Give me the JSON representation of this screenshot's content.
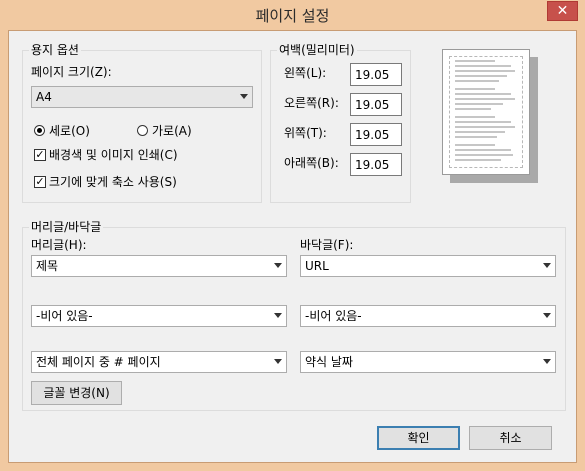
{
  "window": {
    "title": "페이지 설정",
    "close_glyph": "✕"
  },
  "paper_options": {
    "group_label": "용지 옵션",
    "size_label": "페이지 크기(Z):",
    "size_value": "A4",
    "portrait_label": "세로(O)",
    "landscape_label": "가로(A)",
    "orientation_selected": "portrait",
    "print_bg_label": "배경색 및 이미지 인쇄(C)",
    "print_bg_checked": true,
    "shrink_label": "크기에 맞게 축소 사용(S)",
    "shrink_checked": true
  },
  "margins": {
    "group_label": "여백(밀리미터)",
    "left_label": "왼쪽(L):",
    "left_value": "19.05",
    "right_label": "오른쪽(R):",
    "right_value": "19.05",
    "top_label": "위쪽(T):",
    "top_value": "19.05",
    "bottom_label": "아래쪽(B):",
    "bottom_value": "19.05"
  },
  "header_footer": {
    "group_label": "머리글/바닥글",
    "header_label": "머리글(H):",
    "footer_label": "바닥글(F):",
    "header_values": [
      "제목",
      "-비어 있음-",
      "전체 페이지 중 # 페이지"
    ],
    "footer_values": [
      "URL",
      "-비어 있음-",
      "약식 날짜"
    ],
    "font_button": "글꼴 변경(N)"
  },
  "buttons": {
    "ok": "확인",
    "cancel": "취소"
  }
}
